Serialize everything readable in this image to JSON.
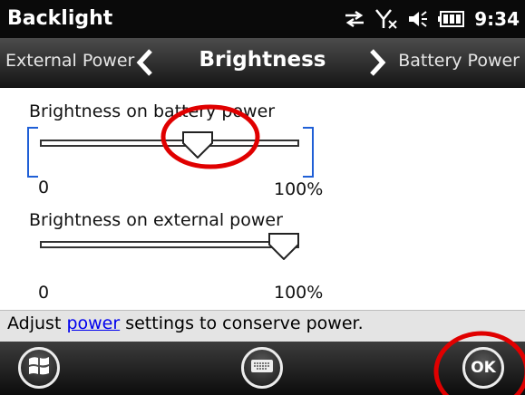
{
  "window": {
    "title": "Backlight",
    "time": "9:34"
  },
  "status_icons": [
    "sync-arrows-icon",
    "signal-off-icon",
    "volume-icon",
    "battery-icon"
  ],
  "nav": {
    "prev": "External Power",
    "current": "Brightness",
    "next": "Battery Power"
  },
  "battery": {
    "label": "Brightness on battery power",
    "min": "0",
    "max": "100%",
    "value_percent": 63
  },
  "external": {
    "label": "Brightness on external power",
    "min": "0",
    "max": "100%",
    "value_percent": 100
  },
  "hint": {
    "prefix": "Adjust ",
    "link": "power",
    "suffix": " settings to conserve power."
  },
  "softkeys": {
    "start_icon": "windows-logo-icon",
    "keyboard_icon": "keyboard-icon",
    "ok": "OK"
  },
  "colors": {
    "focus": "#1f5fd6",
    "annotation": "#e00000",
    "link": "#0000ee"
  }
}
